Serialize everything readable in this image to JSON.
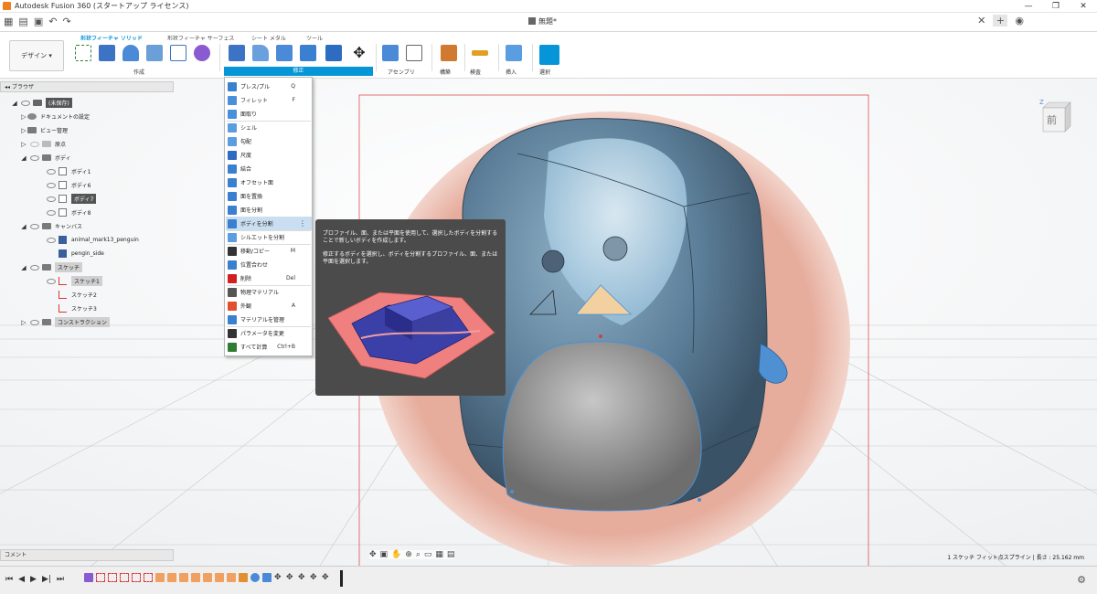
{
  "window": {
    "title": "Autodesk Fusion 360 (スタートアップ ライセンス)",
    "document_name": "無題*"
  },
  "tabs": [
    "形状フィーチャ ソリッド",
    "形状フィーチャ サーフェス",
    "シート メタル",
    "ツール"
  ],
  "workspace": "デザイン",
  "ribbon_groups": {
    "create": "作成",
    "modify": "修正",
    "assemble": "アセンブリ",
    "construct": "構築",
    "inspect": "検査",
    "insert": "挿入",
    "select": "選択"
  },
  "browser": {
    "title": "ブラウザ",
    "items": [
      {
        "label": "(未保存)"
      },
      {
        "label": "ドキュメントの設定"
      },
      {
        "label": "ビュー管理"
      },
      {
        "label": "原点"
      },
      {
        "label": "ボディ"
      },
      {
        "label": "ボディ1"
      },
      {
        "label": "ボディ6"
      },
      {
        "label": "ボディ7"
      },
      {
        "label": "ボディ8"
      },
      {
        "label": "キャンバス"
      },
      {
        "label": "animal_mark13_penguin"
      },
      {
        "label": "pengin_side"
      },
      {
        "label": "スケッチ"
      },
      {
        "label": "スケッチ1"
      },
      {
        "label": "スケッチ2"
      },
      {
        "label": "スケッチ3"
      },
      {
        "label": "コンストラクション"
      }
    ]
  },
  "comments_label": "コメント",
  "menu": {
    "items": [
      {
        "label": "プレス/プル",
        "shortcut": "Q",
        "icon": "press-pull-icon",
        "color": "#3a7fd0"
      },
      {
        "label": "フィレット",
        "shortcut": "F",
        "icon": "fillet-icon",
        "color": "#4a8fdc"
      },
      {
        "label": "面取り",
        "shortcut": "",
        "icon": "chamfer-icon",
        "color": "#4a8fdc"
      },
      {
        "label": "シェル",
        "shortcut": "",
        "icon": "shell-icon",
        "color": "#5a9de0"
      },
      {
        "label": "勾配",
        "shortcut": "",
        "icon": "draft-icon",
        "color": "#5a9de0"
      },
      {
        "label": "尺度",
        "shortcut": "",
        "icon": "scale-icon",
        "color": "#2d6cc0"
      },
      {
        "label": "結合",
        "shortcut": "",
        "icon": "combine-icon",
        "color": "#3a7fd0"
      },
      {
        "label": "オフセット面",
        "shortcut": "",
        "icon": "offset-face-icon",
        "color": "#3a7fd0"
      },
      {
        "label": "面を置換",
        "shortcut": "",
        "icon": "replace-face-icon",
        "color": "#3a7fd0"
      },
      {
        "label": "面を分割",
        "shortcut": "",
        "icon": "split-face-icon",
        "color": "#3a7fd0"
      },
      {
        "label": "ボディを分割",
        "shortcut": "",
        "icon": "split-body-icon",
        "color": "#3a7fd0",
        "selected": true
      },
      {
        "label": "シルエットを分割",
        "shortcut": "",
        "icon": "silhouette-split-icon",
        "color": "#5a9de0"
      },
      {
        "label": "移動/コピー",
        "shortcut": "M",
        "icon": "move-icon",
        "color": "#333333"
      },
      {
        "label": "位置合わせ",
        "shortcut": "",
        "icon": "align-icon",
        "color": "#3a7fd0"
      },
      {
        "label": "削除",
        "shortcut": "Del",
        "icon": "delete-icon",
        "color": "#d22020"
      },
      {
        "label": "物理マテリアル",
        "shortcut": "",
        "icon": "physical-material-icon",
        "color": "#555555"
      },
      {
        "label": "外観",
        "shortcut": "A",
        "icon": "appearance-icon",
        "color": "#e05030"
      },
      {
        "label": "マテリアルを管理",
        "shortcut": "",
        "icon": "manage-materials-icon",
        "color": "#3a7fd0"
      },
      {
        "label": "パラメータを変更",
        "shortcut": "",
        "icon": "parameters-icon",
        "color": "#333333"
      },
      {
        "label": "すべて計算",
        "shortcut": "Ctrl+B",
        "icon": "compute-all-icon",
        "color": "#2e7d32"
      }
    ]
  },
  "tooltip": {
    "line1": "プロファイル、面、または平面を使用して、選択したボディを分割することで新しいボディを作成します。",
    "line2": "修正するボディを選択し、ボディを分割するプロファイル、面、または平面を選択します。"
  },
  "viewcube": {
    "face": "前",
    "axis": "Z"
  },
  "status_text": "1 スケッチ フィット点スプライン | 長さ : 25.162 mm",
  "colors": {
    "accent": "#0696d7",
    "menu_highlight": "#c9def0",
    "penguin_body": "#5c7f9a",
    "canvas_pink": "#e0a898"
  }
}
